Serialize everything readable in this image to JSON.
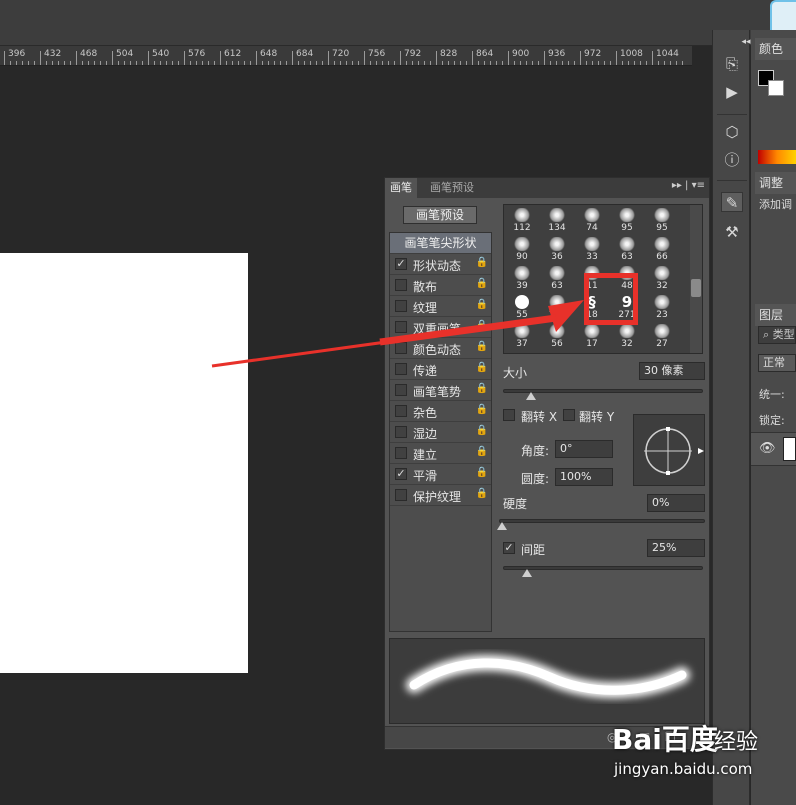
{
  "ruler": {
    "labels": [
      "396",
      "432",
      "468",
      "504",
      "540",
      "576",
      "612",
      "648",
      "684",
      "720",
      "756",
      "792",
      "828",
      "864",
      "900",
      "936",
      "972",
      "1008",
      "1044"
    ]
  },
  "right_dock": {
    "color_tab": "颜色",
    "adjust_tab": "调整",
    "adjust_text": "添加调",
    "layers_tab": "图层",
    "search_text": "类型",
    "blend_mode": "正常",
    "unify_label": "统一:",
    "lock_label": "锁定:"
  },
  "brush_panel": {
    "tabs": [
      "画笔",
      "画笔预设"
    ],
    "preset_button": "画笔预设",
    "tip_header": "画笔笔尖形状",
    "options": [
      {
        "label": "形状动态",
        "checked": true
      },
      {
        "label": "散布",
        "checked": false
      },
      {
        "label": "纹理",
        "checked": false
      },
      {
        "label": "双重画笔",
        "checked": false
      },
      {
        "label": "颜色动态",
        "checked": false
      },
      {
        "label": "传递",
        "checked": false
      },
      {
        "label": "画笔笔势",
        "checked": false
      },
      {
        "label": "杂色",
        "checked": false
      },
      {
        "label": "湿边",
        "checked": false
      },
      {
        "label": "建立",
        "checked": false
      },
      {
        "label": "平滑",
        "checked": true
      },
      {
        "label": "保护纹理",
        "checked": false
      }
    ],
    "tip_sizes": [
      [
        "112",
        "134",
        "74",
        "95",
        "95"
      ],
      [
        "90",
        "36",
        "33",
        "63",
        "66"
      ],
      [
        "39",
        "63",
        "11",
        "48",
        "32"
      ],
      [
        "55",
        "100",
        "18",
        "271",
        "23"
      ],
      [
        "37",
        "56",
        "17",
        "32",
        "27"
      ]
    ],
    "size_label": "大小",
    "size_value": "30 像素",
    "flip_x": "翻转 X",
    "flip_y": "翻转 Y",
    "angle_label": "角度:",
    "angle_value": "0°",
    "roundness_label": "圆度:",
    "roundness_value": "100%",
    "hardness_label": "硬度",
    "hardness_value": "0%",
    "spacing_label": "间距",
    "spacing_value": "25%",
    "spacing_checked": true
  },
  "watermark": {
    "logo": "Bai百度",
    "suffix": "经验",
    "url": "jingyan.baidu.com"
  },
  "colors": {
    "highlight": "#e8312a",
    "accent_tab": "#6fc1e8"
  }
}
